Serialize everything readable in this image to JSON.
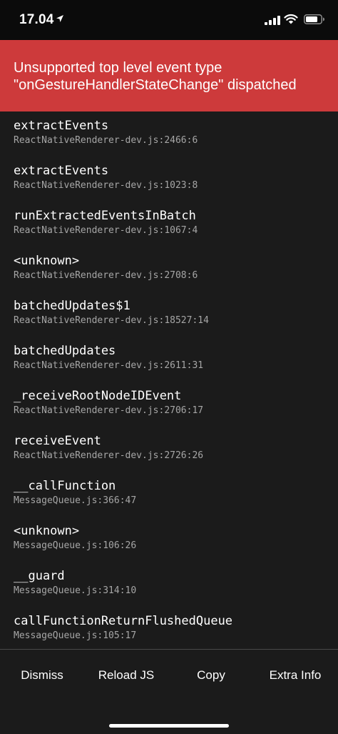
{
  "status_bar": {
    "time": "17.04",
    "icons": [
      "location-arrow-icon",
      "cellular-signal-icon",
      "wifi-icon",
      "battery-icon"
    ]
  },
  "error": {
    "title_line1": "Unsupported top level event type",
    "title_line2": "\"onGestureHandlerStateChange\" dispatched",
    "background_color": "#cd3a3b"
  },
  "stack": [
    {
      "fn": "extractEvents",
      "loc": "ReactNativeRenderer-dev.js:2466:6"
    },
    {
      "fn": "extractEvents",
      "loc": "ReactNativeRenderer-dev.js:1023:8"
    },
    {
      "fn": "runExtractedEventsInBatch",
      "loc": "ReactNativeRenderer-dev.js:1067:4"
    },
    {
      "fn": "<unknown>",
      "loc": "ReactNativeRenderer-dev.js:2708:6"
    },
    {
      "fn": "batchedUpdates$1",
      "loc": "ReactNativeRenderer-dev.js:18527:14"
    },
    {
      "fn": "batchedUpdates",
      "loc": "ReactNativeRenderer-dev.js:2611:31"
    },
    {
      "fn": "_receiveRootNodeIDEvent",
      "loc": "ReactNativeRenderer-dev.js:2706:17"
    },
    {
      "fn": "receiveEvent",
      "loc": "ReactNativeRenderer-dev.js:2726:26"
    },
    {
      "fn": "__callFunction",
      "loc": "MessageQueue.js:366:47"
    },
    {
      "fn": "<unknown>",
      "loc": "MessageQueue.js:106:26"
    },
    {
      "fn": "__guard",
      "loc": "MessageQueue.js:314:10"
    },
    {
      "fn": "callFunctionReturnFlushedQueue",
      "loc": "MessageQueue.js:105:17"
    }
  ],
  "footer": {
    "dismiss": "Dismiss",
    "reload": "Reload JS",
    "copy": "Copy",
    "extra_info": "Extra Info"
  }
}
